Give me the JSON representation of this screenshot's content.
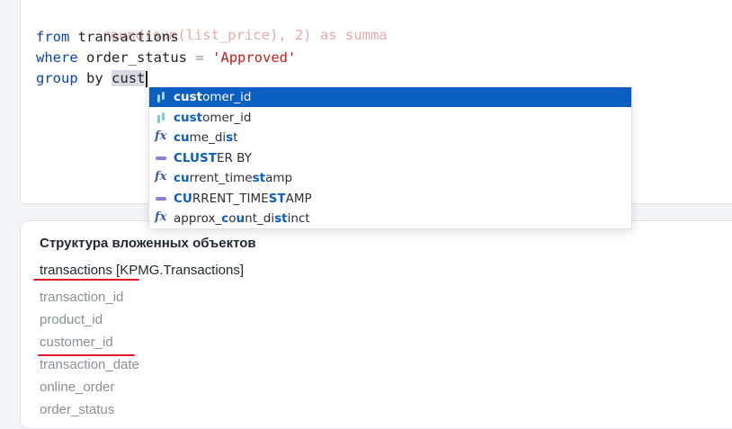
{
  "editor": {
    "line_partial": "round(sum(list_price), 2) as summa",
    "line_from_kw": "from",
    "line_from_table": "transactions",
    "line_where_kw": "where",
    "line_where_col": "order_status",
    "line_where_op": "=",
    "line_where_val": "'Approved'",
    "line_group_kw": "group",
    "line_by_kw": "by",
    "typed_text": "cust"
  },
  "autocomplete": {
    "items": [
      {
        "icon": "column-icon",
        "match": "cust",
        "rest": "omer_id",
        "selected": true
      },
      {
        "icon": "column-icon",
        "match": "cust",
        "rest": "omer_id",
        "selected": false
      },
      {
        "icon": "function-icon",
        "p1": "",
        "m1": "cu",
        "p2": "me_di",
        "m2": "s",
        "p3": "t"
      },
      {
        "icon": "keyword-icon",
        "m1": "CLUST",
        "p2": "ER BY"
      },
      {
        "icon": "function-icon",
        "m1": "cu",
        "p2": "rrent_time",
        "m2": "st",
        "p3": "amp"
      },
      {
        "icon": "keyword-icon",
        "m1": "CU",
        "p2": "RRENT_TIME",
        "m2": "ST",
        "p3": "AMP"
      },
      {
        "icon": "function-icon",
        "p1": "approx_",
        "m1": "c",
        "p2": "o",
        "m2": "u",
        "p3": "nt_di",
        "m3": "st",
        "p4": "inct"
      }
    ]
  },
  "structure_panel": {
    "title": "Структура вложенных объектов",
    "table_label": "transactions [KPMG.Transactions]",
    "fields": [
      "transaction_id",
      "product_id",
      "customer_id",
      "transaction_date",
      "online_order",
      "order_status"
    ]
  },
  "colors": {
    "keyword": "#0d41b8",
    "string": "#c21d1d",
    "selection": "#0b5fc1",
    "annotation_underline": "#e0162b"
  }
}
